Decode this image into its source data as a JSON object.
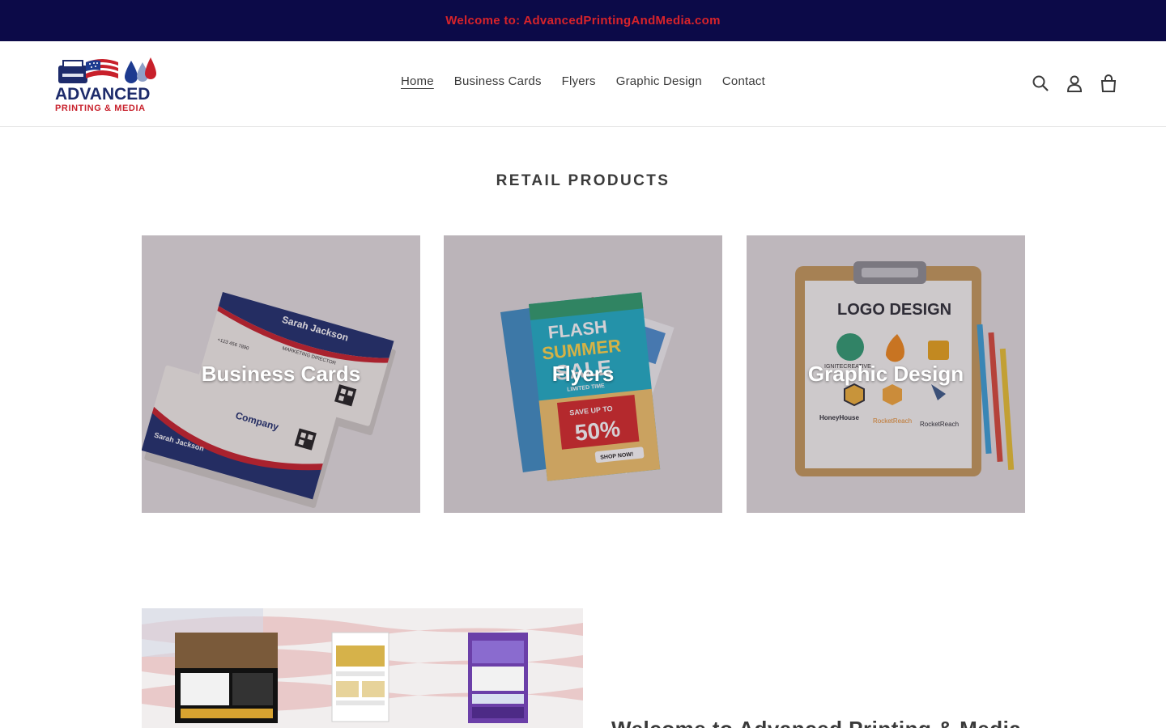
{
  "announcement": {
    "text": "Welcome to: AdvancedPrintingAndMedia.com"
  },
  "logo": {
    "line1": "ADVANCED",
    "line2": "PRINTING & MEDIA"
  },
  "nav": {
    "items": [
      {
        "label": "Home",
        "active": true
      },
      {
        "label": "Business Cards",
        "active": false
      },
      {
        "label": "Flyers",
        "active": false
      },
      {
        "label": "Graphic Design",
        "active": false
      },
      {
        "label": "Contact",
        "active": false
      }
    ]
  },
  "header_icons": [
    "search-icon",
    "account-icon",
    "cart-icon"
  ],
  "retail": {
    "title": "RETAIL PRODUCTS",
    "collections": [
      {
        "label": "Business Cards",
        "card_name": "Sarah Jackson",
        "card_title": "MARKETING DIRECTOR",
        "card_phone": "+123 456 7890",
        "card_company": "Company"
      },
      {
        "label": "Flyers",
        "flyer_line1": "FLASH",
        "flyer_line2": "SUMMER",
        "flyer_line3": "SALE",
        "flyer_limited": "LIMITED TIME",
        "flyer_save": "SAVE UP TO",
        "flyer_percent": "50%",
        "flyer_cta": "SHOP NOW!"
      },
      {
        "label": "Graphic Design",
        "board_title": "LOGO DESIGN",
        "logo_names": [
          "IGNITECREATIVE",
          "HoneyHouse",
          "RocketReach",
          "RocketReach"
        ]
      }
    ]
  },
  "feature": {
    "heading": "Welcome to Advanced Printing & Media"
  },
  "colors": {
    "announcement_bg": "#0c0a48",
    "announcement_text": "#d8232a",
    "text": "#3a3a3a"
  }
}
